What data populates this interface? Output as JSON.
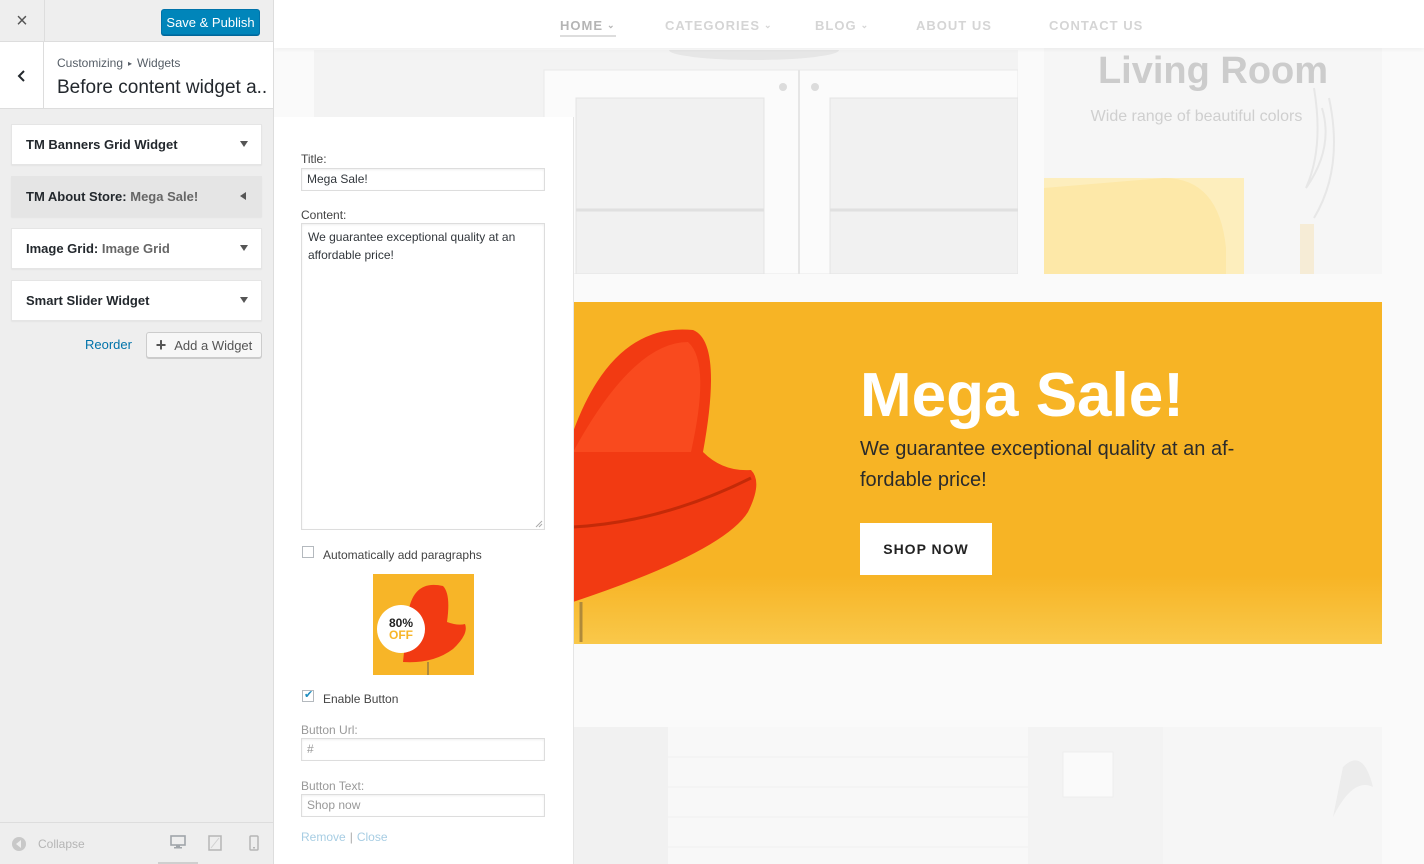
{
  "sidebar": {
    "close_label": "×",
    "publish_label": "Save & Publish",
    "breadcrumb": {
      "root": "Customizing",
      "separator": "▸",
      "current": "Widgets"
    },
    "section_title": "Before content widget a...",
    "widgets": [
      {
        "title": "TM Banners Grid Widget",
        "subtitle": ""
      },
      {
        "title": "TM About Store:",
        "subtitle": "Mega Sale!"
      },
      {
        "title": "Image Grid:",
        "subtitle": "Image Grid"
      },
      {
        "title": "Smart Slider Widget",
        "subtitle": ""
      }
    ],
    "reorder_label": "Reorder",
    "add_widget_label": "Add a Widget",
    "add_widget_icon": "+",
    "collapse_label": "Collapse"
  },
  "form": {
    "title_label": "Title:",
    "title_value": "Mega Sale!",
    "content_label": "Content:",
    "content_value": "We guarantee exceptional quality at an affordable price!",
    "auto_paragraphs_label": "Automatically add paragraphs",
    "auto_paragraphs_checked": false,
    "image_badge_top": "80%",
    "image_badge_bottom": "OFF",
    "enable_button_label": "Enable Button",
    "enable_button_checked": true,
    "button_url_label": "Button Url:",
    "button_url_value": "#",
    "button_text_label": "Button Text:",
    "button_text_value": "Shop now",
    "remove_label": "Remove",
    "actions_separator": "|",
    "close_label": "Close"
  },
  "preview": {
    "nav": [
      {
        "label": "HOME",
        "dropdown": true
      },
      {
        "label": "CATEGORIES",
        "dropdown": true
      },
      {
        "label": "BLOG",
        "dropdown": true
      },
      {
        "label": "ABOUT US",
        "dropdown": false
      },
      {
        "label": "CONTACT US",
        "dropdown": false
      }
    ],
    "nav_chevron": "⌄",
    "room_title": "Living Room",
    "room_subtitle": "Wide range of beautiful colors",
    "sale_title": "Mega Sale!",
    "sale_text": "We guarantee exceptional quality at an af- fordable price!",
    "shop_button": "SHOP NOW"
  },
  "colors": {
    "accent": "#0085ba",
    "sale_background": "#f7b425",
    "chair": "#f23a12"
  }
}
